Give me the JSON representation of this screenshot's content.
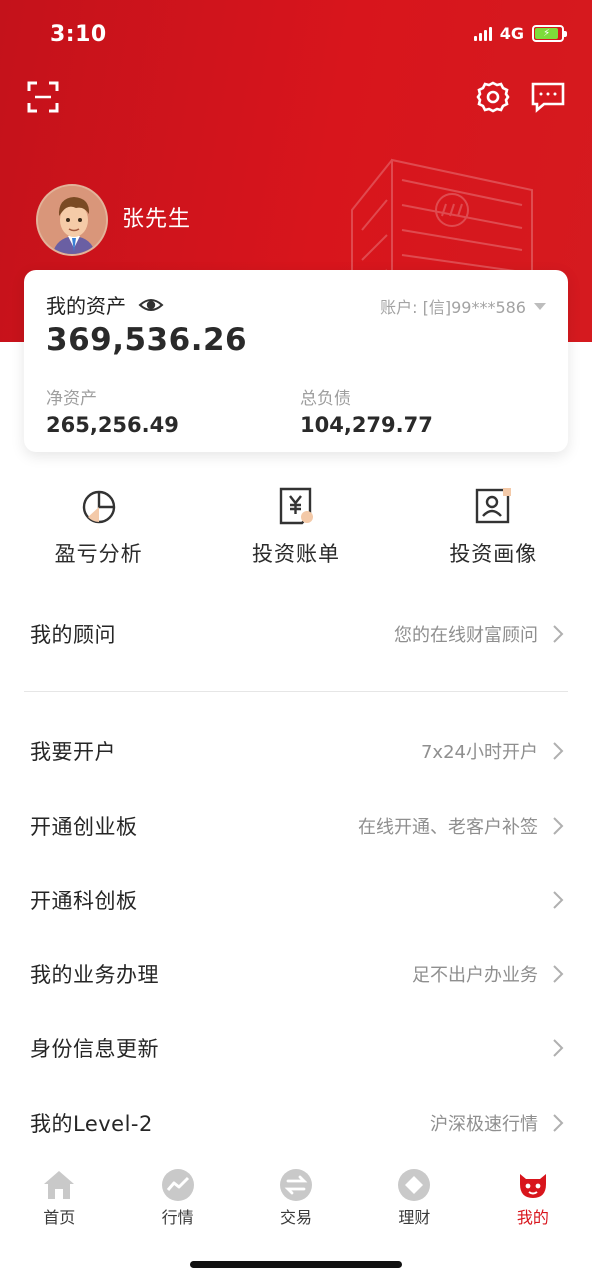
{
  "status_bar": {
    "time": "3:10",
    "network": "4G"
  },
  "user": {
    "name": "张先生"
  },
  "assets": {
    "title": "我的资产",
    "account_label": "账户: [信]99***586",
    "total": "369,536.26",
    "net_assets_label": "净资产",
    "net_assets_value": "265,256.49",
    "liabilities_label": "总负债",
    "liabilities_value": "104,279.77"
  },
  "quick_actions": [
    {
      "label": "盈亏分析",
      "icon": "pie-chart-icon"
    },
    {
      "label": "投资账单",
      "icon": "bill-icon"
    },
    {
      "label": "投资画像",
      "icon": "portrait-icon"
    }
  ],
  "menu": [
    {
      "label": "我的顾问",
      "hint": "您的在线财富顾问"
    },
    {
      "label": "我要开户",
      "hint": "7x24小时开户"
    },
    {
      "label": "开通创业板",
      "hint": "在线开通、老客户补签"
    },
    {
      "label": "开通科创板",
      "hint": ""
    },
    {
      "label": "我的业务办理",
      "hint": "足不出户办业务"
    },
    {
      "label": "身份信息更新",
      "hint": ""
    },
    {
      "label": "我的Level-2",
      "hint": "沪深极速行情"
    }
  ],
  "tabs": [
    {
      "label": "首页",
      "icon": "home-icon",
      "active": false
    },
    {
      "label": "行情",
      "icon": "market-icon",
      "active": false
    },
    {
      "label": "交易",
      "icon": "trade-icon",
      "active": false
    },
    {
      "label": "理财",
      "icon": "wealth-icon",
      "active": false
    },
    {
      "label": "我的",
      "icon": "mine-icon",
      "active": true
    }
  ],
  "colors": {
    "brand_red": "#d8151c",
    "hint_gray": "#8f8f8f",
    "tab_inactive": "#c9c9c9"
  }
}
